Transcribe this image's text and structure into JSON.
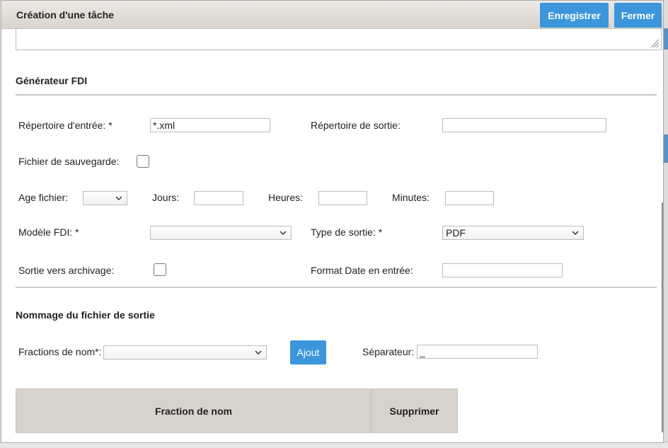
{
  "dialog": {
    "title": "Création d'une tâche",
    "save_label": "Enregistrer",
    "close_label": "Fermer"
  },
  "section_fdi": {
    "title": "Générateur FDI",
    "input_dir_label": "Répertoire d'entrée: *",
    "input_dir_value": "*.xml",
    "output_dir_label": "Répertoire de sortie:",
    "output_dir_value": "",
    "backup_file_label": "Fichier de sauvegarde:",
    "backup_file_checked": false,
    "file_age_label": "Age fichier:",
    "file_age_value": "",
    "days_label": "Jours:",
    "days_value": "",
    "hours_label": "Heures:",
    "hours_value": "",
    "minutes_label": "Minutes:",
    "minutes_value": "",
    "model_label": "Modèle FDI: *",
    "model_value": "",
    "output_type_label": "Type de sortie: *",
    "output_type_value": "PDF",
    "archive_label": "Sortie vers archivage:",
    "archive_checked": false,
    "date_format_label": "Format Date en entrée:",
    "date_format_value": ""
  },
  "section_naming": {
    "title": "Nommage du fichier de sortie",
    "fractions_label": "Fractions de nom*:",
    "fractions_value": "",
    "add_label": "Ajout",
    "separator_label": "Séparateur:",
    "separator_value": "_",
    "table_headers": [
      "Fraction de nom",
      "Supprimer"
    ]
  },
  "icons": [
    "chevron-down-icon",
    "resize-grip-icon"
  ],
  "colors": {
    "accent": "#3b96dc",
    "header_bg": "#d7d2cb"
  }
}
